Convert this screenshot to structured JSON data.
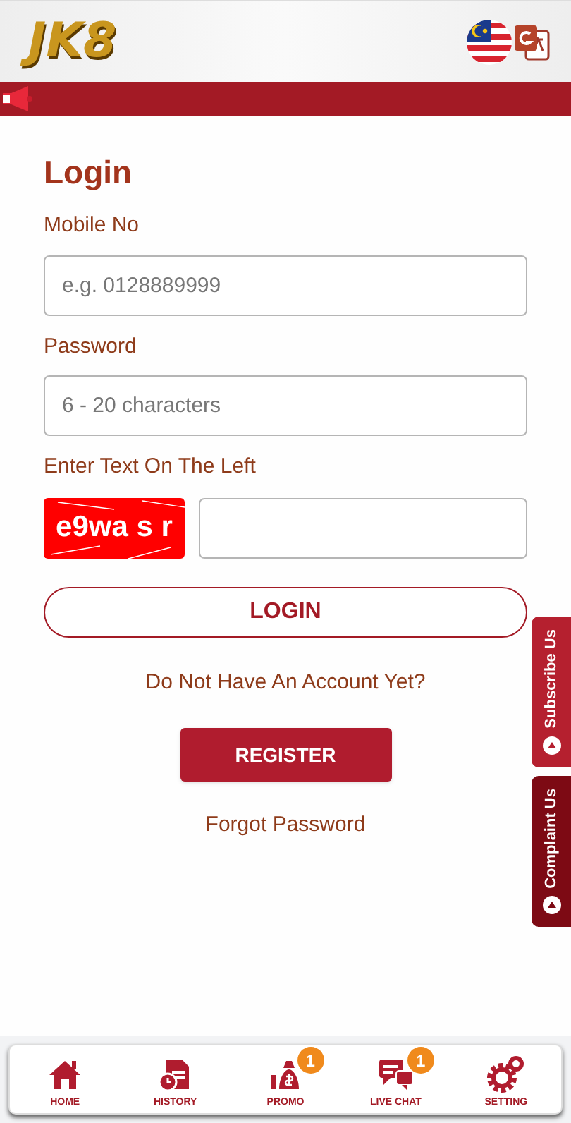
{
  "header": {
    "logo": "JK8"
  },
  "login": {
    "title": "Login",
    "fields": [
      {
        "label": "Mobile No",
        "placeholder": "e.g. 0128889999"
      },
      {
        "label": "Password",
        "placeholder": "6 - 20 characters"
      }
    ],
    "captcha": {
      "label": "Enter Text On The Left",
      "code": "e9wa s r"
    },
    "login_button": "LOGIN",
    "prompt": "Do Not Have An Account Yet?",
    "register_button": "REGISTER",
    "forgot_link": "Forgot Password"
  },
  "side_tabs": [
    {
      "label": "Subscribe Us",
      "color": "#b5202f"
    },
    {
      "label": "Complaint Us",
      "color": "#7d0a14"
    }
  ],
  "bottom_nav": [
    {
      "kind": "home",
      "label": "HOME"
    },
    {
      "kind": "history",
      "label": "HISTORY"
    },
    {
      "kind": "promo",
      "label": "PROMO",
      "badge": "1"
    },
    {
      "kind": "chat",
      "label": "LIVE CHAT",
      "badge": "1"
    },
    {
      "kind": "setting",
      "label": "SETTING"
    }
  ]
}
